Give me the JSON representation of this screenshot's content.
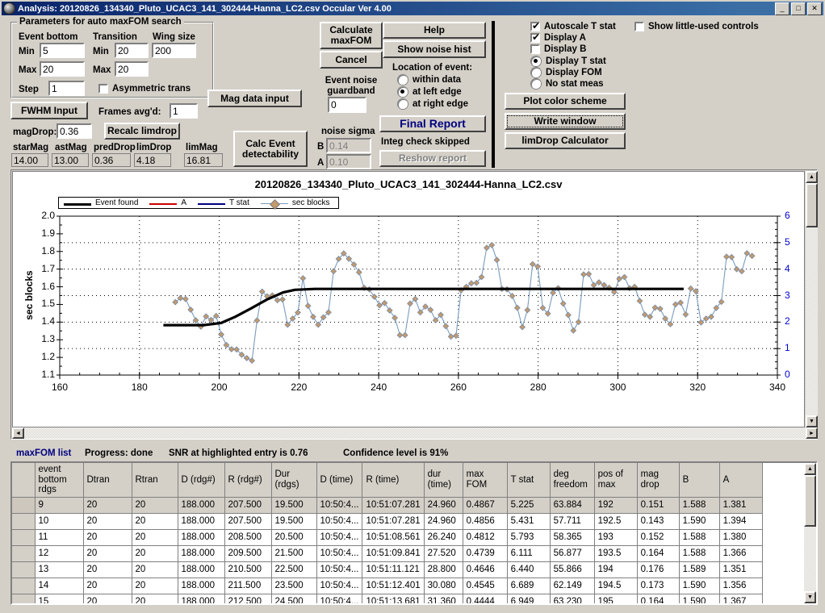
{
  "window": {
    "title": "Analysis: 20120826_134340_Pluto_UCAC3_141_302444-Hanna_LC2.csv  Occular Ver 4.00",
    "minimize": "_",
    "maximize": "□",
    "close": "✕"
  },
  "params_group": {
    "legend": "Parameters for auto maxFOM search",
    "col_event_bottom": "Event bottom",
    "col_transition": "Transition",
    "col_wing_size": "Wing size",
    "min_label": "Min",
    "max_label": "Max",
    "step_label": "Step",
    "event_bottom_min": "5",
    "event_bottom_max": "20",
    "event_bottom_step": "1",
    "transition_min": "20",
    "transition_max": "20",
    "wing_size": "200",
    "asymmetric_trans": "Asymmetric trans"
  },
  "left_controls": {
    "fwhm_input": "FWHM Input",
    "frames_avgd_label": "Frames avg'd:",
    "frames_avgd": "1",
    "magdrop_label": "magDrop:",
    "magdrop": "0.36",
    "recalc_limdrop": "Recalc limdrop",
    "mag_data_input": "Mag data input",
    "calc_event_detectability": "Calc Event detectability",
    "stats": [
      {
        "label": "starMag",
        "value": "14.00"
      },
      {
        "label": "astMag",
        "value": "13.00"
      },
      {
        "label": "predDrop",
        "value": "0.36"
      },
      {
        "label": "limDrop",
        "value": "4.18"
      },
      {
        "label": "limMag",
        "value": "16.81"
      }
    ]
  },
  "mid_controls": {
    "calculate_maxfom": "Calculate maxFOM",
    "cancel": "Cancel",
    "event_noise_guardband_label": "Event noise guardband",
    "event_noise_guardband": "0",
    "noise_sigma_label": "noise sigma",
    "noise_sigma_b_label": "B",
    "noise_sigma_b": "0.14",
    "noise_sigma_a_label": "A",
    "noise_sigma_a": "0.10"
  },
  "right_controls": {
    "help": "Help",
    "show_noise_hist": "Show noise hist",
    "location_of_event_label": "Location of event:",
    "location_options": [
      "within data",
      "at left edge",
      "at right edge"
    ],
    "location_selected": 1,
    "final_report": "Final Report",
    "integ_check_skipped": "Integ check skipped",
    "reshow_report": "Reshow report",
    "autoscale_t_stat": "Autoscale T stat",
    "display_a": "Display A",
    "display_b": "Display B",
    "autoscale_checked": true,
    "display_a_checked": true,
    "display_b_checked": false,
    "stat_options": [
      "Display T stat",
      "Display FOM",
      "No stat meas"
    ],
    "stat_selected": 0,
    "plot_color_scheme": "Plot color scheme",
    "write_window": "Write window",
    "limdrop_calculator": "limDrop Calculator",
    "show_little_used_controls": "Show little-used controls",
    "show_little_used_checked": false
  },
  "chart_data": {
    "type": "line",
    "title": "20120826_134340_Pluto_UCAC3_141_302444-Hanna_LC2.csv",
    "xlabel": "",
    "ylabel": "sec blocks",
    "ylabel_right": "T stat",
    "xlim": [
      160,
      340
    ],
    "ylim": [
      1.1,
      2.0
    ],
    "ylim_right": [
      0,
      6
    ],
    "xticks": [
      160,
      180,
      200,
      220,
      240,
      260,
      280,
      300,
      320,
      340
    ],
    "yticks": [
      1.1,
      1.2,
      1.3,
      1.4,
      1.5,
      1.6,
      1.7,
      1.8,
      1.9,
      2.0
    ],
    "yticks_right": [
      0,
      1,
      2,
      3,
      4,
      5,
      6
    ],
    "gridlines_y": [
      1.25,
      1.4,
      1.55,
      1.7,
      1.85
    ],
    "gridlines_x": [
      180,
      200,
      220,
      240,
      260,
      280,
      300,
      320
    ],
    "grid": true,
    "legend_position": "top-left",
    "legend": [
      {
        "name": "Event found",
        "color": "#000000",
        "width": 3
      },
      {
        "name": "A",
        "color": "#cc0000",
        "width": 2
      },
      {
        "name": "T stat",
        "color": "#000080",
        "width": 2
      },
      {
        "name": "sec blocks",
        "color": "#7a9bbf",
        "width": 1,
        "marker": "diamond",
        "marker_color": "#c49a6c"
      }
    ],
    "series": [
      {
        "name": "Event found",
        "color": "#000000",
        "type": "step-sigmoid",
        "points": [
          [
            186.0,
            1.383
          ],
          [
            196.0,
            1.383
          ],
          [
            200.5,
            1.395
          ],
          [
            204.0,
            1.43
          ],
          [
            208.0,
            1.478
          ],
          [
            212.0,
            1.528
          ],
          [
            216.0,
            1.568
          ],
          [
            219.0,
            1.583
          ],
          [
            224.0,
            1.588
          ],
          [
            316.5,
            1.588
          ]
        ]
      },
      {
        "name": "sec blocks",
        "color": "#7a9bbf",
        "marker": "diamond",
        "marker_color": "#c49a6c",
        "x_start": 189.0,
        "x_step": 1.28,
        "values": [
          1.513,
          1.536,
          1.531,
          1.47,
          1.41,
          1.374,
          1.432,
          1.412,
          1.435,
          1.33,
          1.27,
          1.246,
          1.245,
          1.215,
          1.196,
          1.182,
          1.409,
          1.573,
          1.546,
          1.551,
          1.524,
          1.528,
          1.385,
          1.42,
          1.454,
          1.648,
          1.492,
          1.43,
          1.385,
          1.427,
          1.455,
          1.688,
          1.758,
          1.789,
          1.759,
          1.726,
          1.682,
          1.594,
          1.585,
          1.543,
          1.495,
          1.508,
          1.466,
          1.424,
          1.326,
          1.326,
          1.505,
          1.531,
          1.455,
          1.488,
          1.469,
          1.41,
          1.441,
          1.377,
          1.318,
          1.323,
          1.58,
          1.6,
          1.62,
          1.622,
          1.655,
          1.821,
          1.836,
          1.752,
          1.588,
          1.585,
          1.548,
          1.481,
          1.372,
          1.468,
          1.728,
          1.715,
          1.48,
          1.448,
          1.566,
          1.592,
          1.505,
          1.44,
          1.352,
          1.4,
          1.67,
          1.672,
          1.61,
          1.625,
          1.61,
          1.595,
          1.57,
          1.645,
          1.655,
          1.592,
          1.6,
          1.52,
          1.442,
          1.43,
          1.482,
          1.475,
          1.42,
          1.388,
          1.5,
          1.51,
          1.443,
          1.59,
          1.575,
          1.398,
          1.42,
          1.43,
          1.48,
          1.515,
          1.77,
          1.768,
          1.7,
          1.688,
          1.79,
          1.775
        ]
      }
    ]
  },
  "status": {
    "list_label": "maxFOM list",
    "progress": "Progress: done",
    "snr": "SNR at highlighted entry is 0.76",
    "confidence": "Confidence level is 91%"
  },
  "table": {
    "columns": [
      {
        "label": "event bottom rdgs",
        "width": 60
      },
      {
        "label": "Dtran",
        "width": 60
      },
      {
        "label": "Rtran",
        "width": 57
      },
      {
        "label": "D (rdg#)",
        "width": 58
      },
      {
        "label": "R (rdg#)",
        "width": 58
      },
      {
        "label": "Dur (rdgs)",
        "width": 56
      },
      {
        "label": "D (time)",
        "width": 52
      },
      {
        "label": "R (time)",
        "width": 67
      },
      {
        "label": "dur (time)",
        "width": 48
      },
      {
        "label": "max FOM",
        "width": 55
      },
      {
        "label": "T stat",
        "width": 53
      },
      {
        "label": "deg freedom",
        "width": 55
      },
      {
        "label": "pos of max",
        "width": 53
      },
      {
        "label": "mag drop",
        "width": 52
      },
      {
        "label": "B",
        "width": 50
      },
      {
        "label": "A",
        "width": 53
      }
    ],
    "rows": [
      {
        "selected": true,
        "cells": [
          "9",
          "20",
          "20",
          "188.000",
          "207.500",
          "19.500",
          "10:50:4...",
          "10:51:07.281",
          "24.960",
          "0.4867",
          "5.225",
          "63.884",
          "192",
          "0.151",
          "1.588",
          "1.381"
        ]
      },
      {
        "selected": false,
        "cells": [
          "10",
          "20",
          "20",
          "188.000",
          "207.500",
          "19.500",
          "10:50:4...",
          "10:51:07.281",
          "24.960",
          "0.4856",
          "5.431",
          "57.711",
          "192.5",
          "0.143",
          "1.590",
          "1.394"
        ]
      },
      {
        "selected": false,
        "cells": [
          "11",
          "20",
          "20",
          "188.000",
          "208.500",
          "20.500",
          "10:50:4...",
          "10:51:08.561",
          "26.240",
          "0.4812",
          "5.793",
          "58.365",
          "193",
          "0.152",
          "1.588",
          "1.380"
        ]
      },
      {
        "selected": false,
        "cells": [
          "12",
          "20",
          "20",
          "188.000",
          "209.500",
          "21.500",
          "10:50:4...",
          "10:51:09.841",
          "27.520",
          "0.4739",
          "6.111",
          "56.877",
          "193.5",
          "0.164",
          "1.588",
          "1.366"
        ]
      },
      {
        "selected": false,
        "cells": [
          "13",
          "20",
          "20",
          "188.000",
          "210.500",
          "22.500",
          "10:50:4...",
          "10:51:11.121",
          "28.800",
          "0.4646",
          "6.440",
          "55.866",
          "194",
          "0.176",
          "1.589",
          "1.351"
        ]
      },
      {
        "selected": false,
        "cells": [
          "14",
          "20",
          "20",
          "188.000",
          "211.500",
          "23.500",
          "10:50:4...",
          "10:51:12.401",
          "30.080",
          "0.4545",
          "6.689",
          "62.149",
          "194.5",
          "0.173",
          "1.590",
          "1.356"
        ]
      },
      {
        "selected": false,
        "cells": [
          "15",
          "20",
          "20",
          "188.000",
          "212.500",
          "24.500",
          "10:50:4...",
          "10:51:13.681",
          "31.360",
          "0.4444",
          "6.949",
          "63.230",
          "195",
          "0.164",
          "1.590",
          "1.367"
        ]
      }
    ]
  },
  "scroll": {
    "up_arrow": "▲",
    "down_arrow": "▼",
    "left_arrow": "◄",
    "right_arrow": "►"
  }
}
